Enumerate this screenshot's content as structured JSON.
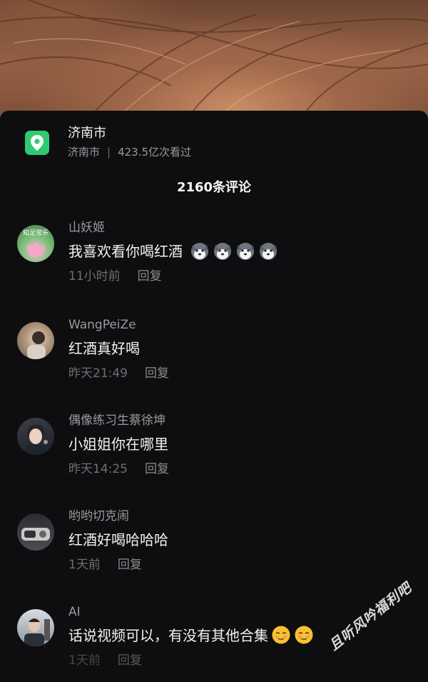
{
  "location": {
    "title": "济南市",
    "subtitle_city": "济南市",
    "separator": "|",
    "views": "423.5亿次看过",
    "icon": "map-pin-icon",
    "accent": "#2ecb72"
  },
  "comments_header": {
    "count_label": "2160条评论"
  },
  "comments": [
    {
      "user": "山妖姬",
      "text": "我喜欢看你喝红酒",
      "time": "11小时前",
      "reply": "回复",
      "avatar_caption": "知足常乐",
      "emoji": "husky-emoji"
    },
    {
      "user": "WangPeiZe",
      "text": "红酒真好喝",
      "time": "昨天21:49",
      "reply": "回复"
    },
    {
      "user": "偶像练习生蔡徐坤",
      "text": "小姐姐你在哪里",
      "time": "昨天14:25",
      "reply": "回复"
    },
    {
      "user": "哟哟切克闹",
      "text": "红酒好喝哈哈哈",
      "time": "1天前",
      "reply": "回复"
    },
    {
      "user": "AI",
      "text": "话说视频可以，有没有其他合集",
      "time": "1天前",
      "reply": "回复",
      "emoji": "relieved-emoji"
    }
  ],
  "watermark": "且听风吟福利吧"
}
